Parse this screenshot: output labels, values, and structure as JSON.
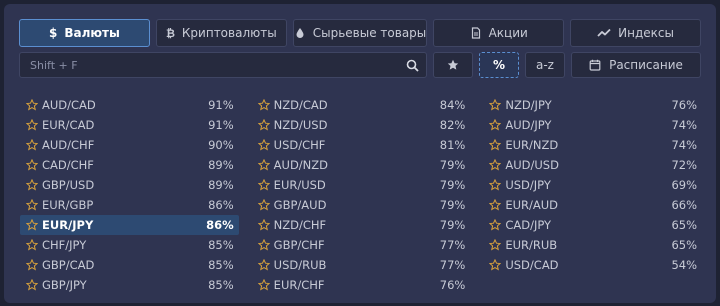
{
  "categories": [
    {
      "label": "Валюты",
      "icon": "dollar-icon",
      "active": true
    },
    {
      "label": "Криптовалюты",
      "icon": "bitcoin-icon",
      "active": false
    },
    {
      "label": "Сырьевые товары",
      "icon": "drop-icon",
      "active": false
    },
    {
      "label": "Акции",
      "icon": "document-icon",
      "active": false
    },
    {
      "label": "Индексы",
      "icon": "trend-icon",
      "active": false
    }
  ],
  "search": {
    "placeholder": "Shift + F"
  },
  "sort": {
    "percent_label": "%",
    "az_label": "a-z",
    "schedule_label": "Расписание",
    "active": "percent"
  },
  "colors": {
    "accent": "#5b8fd1",
    "star": "#d9a23c",
    "active_row": "#2d4a72"
  },
  "columns": [
    [
      {
        "pair": "AUD/CAD",
        "percent": "91%"
      },
      {
        "pair": "EUR/CAD",
        "percent": "91%"
      },
      {
        "pair": "AUD/CHF",
        "percent": "90%"
      },
      {
        "pair": "CAD/CHF",
        "percent": "89%"
      },
      {
        "pair": "GBP/USD",
        "percent": "89%"
      },
      {
        "pair": "EUR/GBP",
        "percent": "86%"
      },
      {
        "pair": "EUR/JPY",
        "percent": "86%",
        "selected": true
      },
      {
        "pair": "CHF/JPY",
        "percent": "85%"
      },
      {
        "pair": "GBP/CAD",
        "percent": "85%"
      },
      {
        "pair": "GBP/JPY",
        "percent": "85%"
      }
    ],
    [
      {
        "pair": "NZD/CAD",
        "percent": "84%"
      },
      {
        "pair": "NZD/USD",
        "percent": "82%"
      },
      {
        "pair": "USD/CHF",
        "percent": "81%"
      },
      {
        "pair": "AUD/NZD",
        "percent": "79%"
      },
      {
        "pair": "EUR/USD",
        "percent": "79%"
      },
      {
        "pair": "GBP/AUD",
        "percent": "79%"
      },
      {
        "pair": "NZD/CHF",
        "percent": "79%"
      },
      {
        "pair": "GBP/CHF",
        "percent": "77%"
      },
      {
        "pair": "USD/RUB",
        "percent": "77%"
      },
      {
        "pair": "EUR/CHF",
        "percent": "76%"
      }
    ],
    [
      {
        "pair": "NZD/JPY",
        "percent": "76%"
      },
      {
        "pair": "AUD/JPY",
        "percent": "74%"
      },
      {
        "pair": "EUR/NZD",
        "percent": "74%"
      },
      {
        "pair": "AUD/USD",
        "percent": "72%"
      },
      {
        "pair": "USD/JPY",
        "percent": "69%"
      },
      {
        "pair": "EUR/AUD",
        "percent": "66%"
      },
      {
        "pair": "CAD/JPY",
        "percent": "65%"
      },
      {
        "pair": "EUR/RUB",
        "percent": "65%"
      },
      {
        "pair": "USD/CAD",
        "percent": "54%"
      }
    ]
  ]
}
